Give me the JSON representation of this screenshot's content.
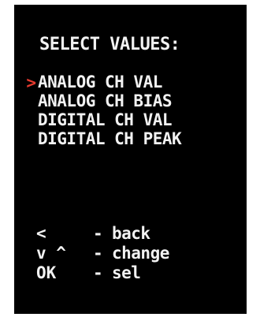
{
  "colors": {
    "background": "#000000",
    "text": "#f2f2f2",
    "cursor": "#e53a2e"
  },
  "menu": {
    "title": "SELECT VALUES:",
    "cursor_glyph": ">",
    "selected_index": 0,
    "items": [
      {
        "label": "ANALOG CH VAL"
      },
      {
        "label": "ANALOG CH BIAS"
      },
      {
        "label": "DIGITAL CH VAL"
      },
      {
        "label": "DIGITAL CH PEAK"
      }
    ]
  },
  "help": {
    "rows": [
      {
        "key": "<",
        "dash": "-",
        "desc": "back"
      },
      {
        "key": "v ^",
        "dash": "-",
        "desc": "change"
      },
      {
        "key": "OK",
        "dash": "-",
        "desc": "sel"
      }
    ]
  }
}
